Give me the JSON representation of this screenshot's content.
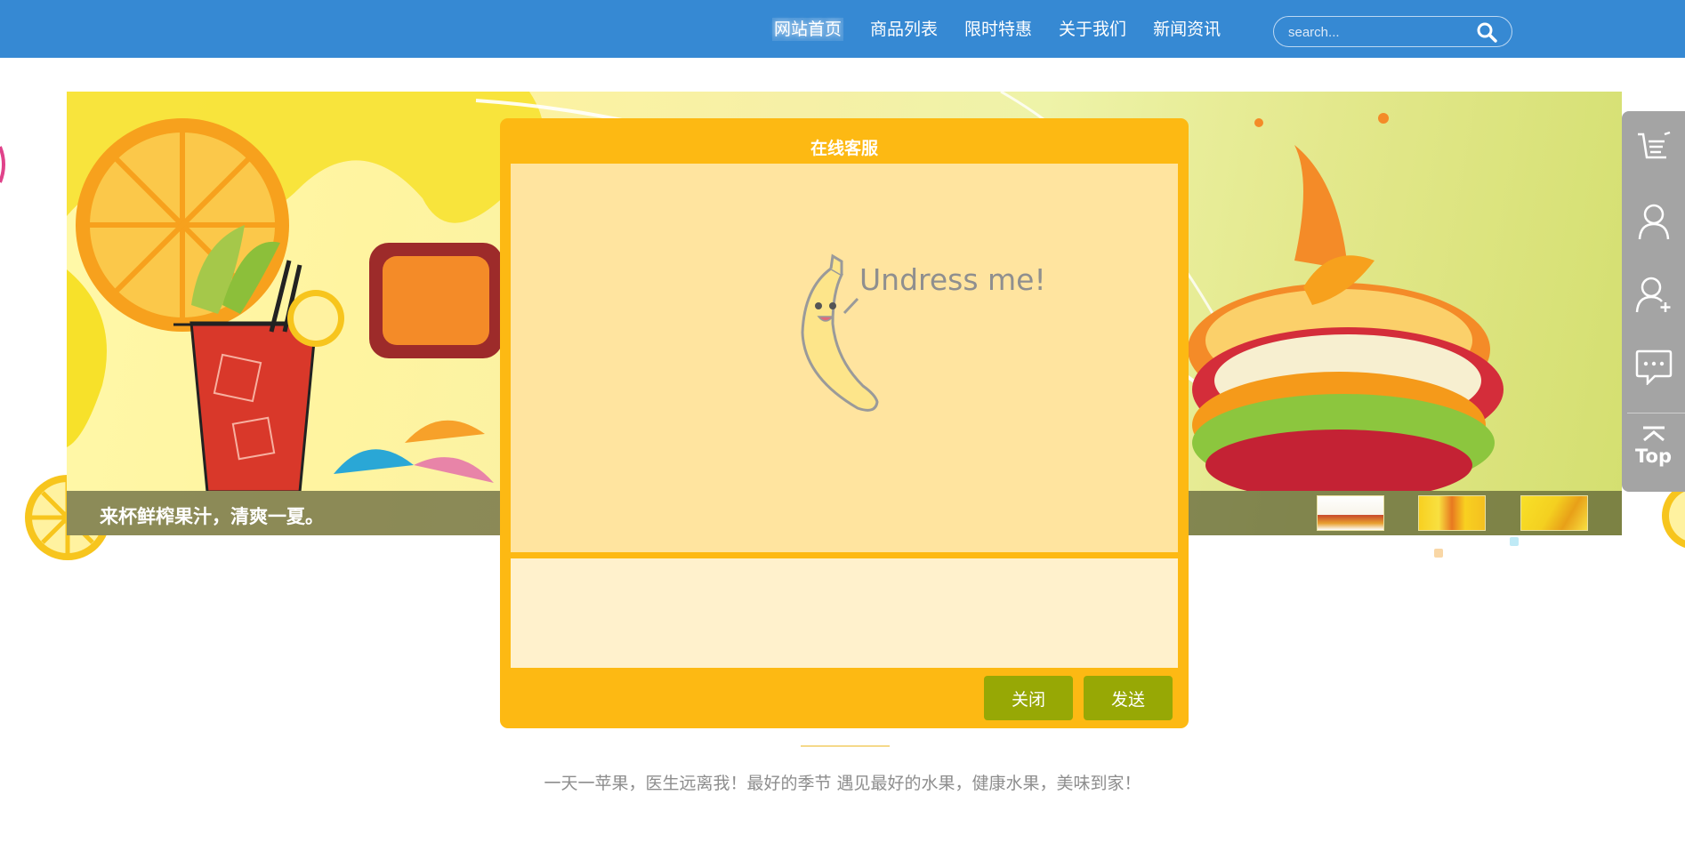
{
  "nav": {
    "links": [
      "网站首页",
      "商品列表",
      "限时特惠",
      "关于我们",
      "新闻资讯"
    ],
    "active_index": 0
  },
  "search": {
    "placeholder": "search..."
  },
  "banner": {
    "caption": "来杯鲜榨果汁，清爽一夏。",
    "thumbnail_count": 3
  },
  "side_toolbar": {
    "items": [
      "cart-list-icon",
      "user-icon",
      "add-user-icon",
      "chat-bubble-icon",
      "back-to-top-icon"
    ],
    "top_label": "Top"
  },
  "chat": {
    "title": "在线客服",
    "mascot_text": "Undress me!",
    "input_value": "",
    "close_label": "关闭",
    "send_label": "发送"
  },
  "footer": {
    "tagline": "一天一苹果，医生远离我！最好的季节 遇见最好的水果，健康水果，美味到家！"
  },
  "colors": {
    "nav_bg": "#3689d3",
    "modal_bg": "#fdb913",
    "messages_bg": "#ffe49f",
    "input_bg": "#fff1cc",
    "button_bg": "#97a805",
    "toolbar_bg": "#a4a4a4"
  }
}
